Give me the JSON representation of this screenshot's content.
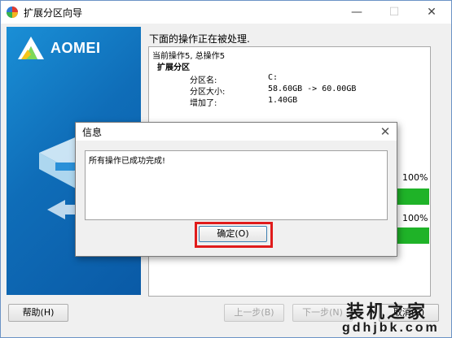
{
  "window": {
    "title": "扩展分区向导",
    "minimize_glyph": "—",
    "maximize_glyph": "☐",
    "close_glyph": "✕"
  },
  "banner": {
    "brand": "AOMEI",
    "brand_color": "#0f6db8"
  },
  "main": {
    "heading": "下面的操作正在被处理.",
    "log": {
      "line1": "当前操作5, 总操作5",
      "section": "扩展分区",
      "rows": [
        {
          "label": "分区名:",
          "value": "C:"
        },
        {
          "label": "分区大小:",
          "value": "58.60GB -> 60.00GB"
        },
        {
          "label": "增加了:",
          "value": "1.40GB"
        }
      ]
    },
    "progress": [
      {
        "percent_label": "100%",
        "fraction": 1.0
      },
      {
        "percent_label": "100%",
        "fraction": 1.0
      }
    ],
    "progress_color": "#1fb328"
  },
  "buttons": {
    "help": "帮助(H)",
    "back": "上一步(B)",
    "next": "下一步(N)",
    "cancel": "取消(C)"
  },
  "dialog": {
    "title": "信息",
    "close_glyph": "✕",
    "message": "所有操作已成功完成!",
    "ok": "确定(O)",
    "highlight_color": "#e01b1b"
  },
  "watermark": {
    "line1": "装机之家",
    "line2": "gdhjbk.com"
  }
}
